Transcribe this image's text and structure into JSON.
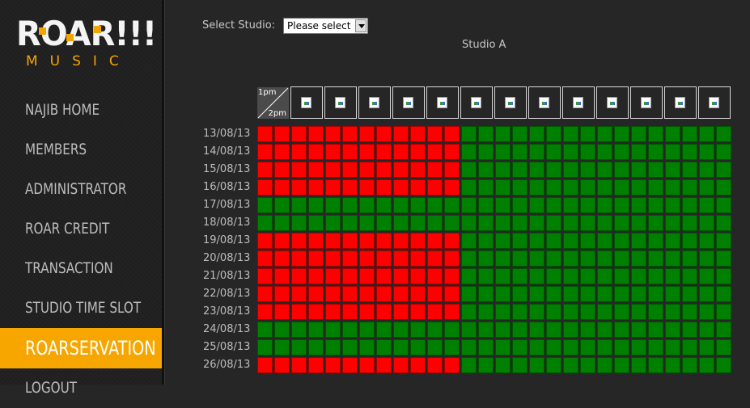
{
  "logo": {
    "main": "ROAR!!!",
    "sub": "MUSIC"
  },
  "nav": [
    {
      "label": "NAJIB HOME",
      "active": false
    },
    {
      "label": "MEMBERS",
      "active": false
    },
    {
      "label": "ADMINISTRATOR",
      "active": false
    },
    {
      "label": "ROAR CREDIT",
      "active": false
    },
    {
      "label": "TRANSACTION",
      "active": false
    },
    {
      "label": "STUDIO TIME SLOT",
      "active": false
    },
    {
      "label": "ROARSERVATION",
      "active": true
    },
    {
      "label": "LOGOUT",
      "active": false
    }
  ],
  "studio_select": {
    "label": "Select Studio:",
    "value": "Please select"
  },
  "studio_title": "Studio A",
  "grid": {
    "corner_top": "1pm",
    "corner_bottom": "2pm",
    "header_icons": 13,
    "slots_per_row": 28,
    "colors": {
      "booked": "#ff0000",
      "available": "#008000"
    },
    "rows": [
      {
        "date": "13/08/13",
        "booked_slots": 12
      },
      {
        "date": "14/08/13",
        "booked_slots": 12
      },
      {
        "date": "15/08/13",
        "booked_slots": 12
      },
      {
        "date": "16/08/13",
        "booked_slots": 12
      },
      {
        "date": "17/08/13",
        "booked_slots": 0
      },
      {
        "date": "18/08/13",
        "booked_slots": 0
      },
      {
        "date": "19/08/13",
        "booked_slots": 12
      },
      {
        "date": "20/08/13",
        "booked_slots": 12
      },
      {
        "date": "21/08/13",
        "booked_slots": 12
      },
      {
        "date": "22/08/13",
        "booked_slots": 12
      },
      {
        "date": "23/08/13",
        "booked_slots": 12
      },
      {
        "date": "24/08/13",
        "booked_slots": 0
      },
      {
        "date": "25/08/13",
        "booked_slots": 0
      },
      {
        "date": "26/08/13",
        "booked_slots": 12
      }
    ]
  }
}
